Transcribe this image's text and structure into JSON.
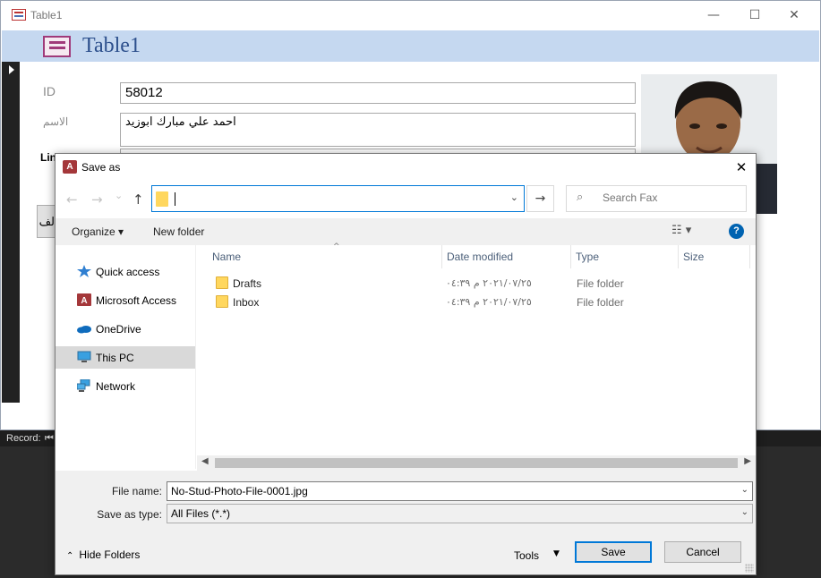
{
  "background_window": {
    "title": "Table1",
    "form_title": "Table1",
    "controls": {
      "minimize": "—",
      "maximize": "☐",
      "close": "✕"
    },
    "fields": {
      "id_label": "ID",
      "id_value": "58012",
      "name_label": "الاسم",
      "name_value": "احمد علي مبارك ابوزيد",
      "partial_label": "Lin"
    },
    "button_partial": "لف"
  },
  "status_bar": {
    "record_label": "Record:",
    "nav_first": "⏮"
  },
  "dialog": {
    "title": "Save as",
    "close": "✕",
    "nav": {
      "back": "←",
      "forward": "→",
      "recent": "⌄",
      "up": "↑"
    },
    "address_value": "",
    "go": "→",
    "search_placeholder": "Search Fax",
    "search_icon": "⌕",
    "command_bar": {
      "organize": "Organize ▾",
      "new_folder": "New folder",
      "view_icon": "☷ ▾",
      "help": "?"
    },
    "nav_pane": [
      {
        "label": "Quick access",
        "icon": "star-icon"
      },
      {
        "label": "Microsoft Access",
        "icon": "access-icon"
      },
      {
        "label": "OneDrive",
        "icon": "cloud-icon"
      },
      {
        "label": "This PC",
        "icon": "pc-icon",
        "selected": true
      },
      {
        "label": "Network",
        "icon": "network-icon"
      }
    ],
    "columns": [
      "Name",
      "Date modified",
      "Type",
      "Size"
    ],
    "files": [
      {
        "name": "Drafts",
        "date": "٢٠٢١/٠٧/٢٥ م ٠٤:٣٩",
        "type": "File folder"
      },
      {
        "name": "Inbox",
        "date": "٢٠٢١/٠٧/٢٥ م ٠٤:٣٩",
        "type": "File folder"
      }
    ],
    "file_name_label": "File name:",
    "file_name_value": "No-Stud-Photo-File-0001.jpg",
    "save_as_type_label": "Save as type:",
    "save_as_type_value": "All Files (*.*)",
    "hide_folders": "Hide Folders",
    "tools": "Tools",
    "save": "Save",
    "cancel": "Cancel"
  }
}
